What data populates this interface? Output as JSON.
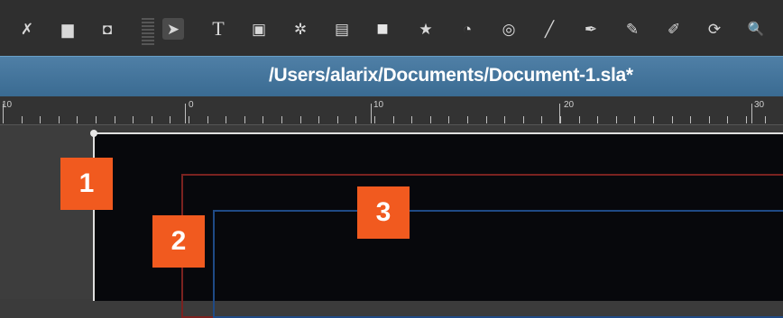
{
  "toolbar": {
    "tools": [
      {
        "name": "cut-icon",
        "glyph": "✗"
      },
      {
        "name": "copy-icon",
        "glyph": "▆"
      },
      {
        "name": "paste-icon",
        "glyph": "◘"
      },
      {
        "name": "select-icon",
        "glyph": "➤"
      },
      {
        "name": "text-frame-icon",
        "glyph": "T"
      },
      {
        "name": "image-frame-icon",
        "glyph": "▣"
      },
      {
        "name": "render-frame-icon",
        "glyph": "✲"
      },
      {
        "name": "table-icon",
        "glyph": "▤"
      },
      {
        "name": "shape-icon",
        "glyph": "■"
      },
      {
        "name": "polygon-icon",
        "glyph": "★"
      },
      {
        "name": "arc-icon",
        "glyph": "◔"
      },
      {
        "name": "spiral-icon",
        "glyph": "◎"
      },
      {
        "name": "line-icon",
        "glyph": "╱"
      },
      {
        "name": "bezier-icon",
        "glyph": "✒"
      },
      {
        "name": "freehand-icon",
        "glyph": "✎"
      },
      {
        "name": "calligraphic-icon",
        "glyph": "✐"
      },
      {
        "name": "rotate-icon",
        "glyph": "⟳"
      },
      {
        "name": "zoom-icon",
        "glyph": "🔍"
      }
    ]
  },
  "titlebar": {
    "path": "/Users/alarix/Documents/Document-1.sla*"
  },
  "ruler": {
    "labels": [
      "10",
      "0",
      "10",
      "20",
      "30"
    ]
  },
  "markers": [
    "1",
    "2",
    "3"
  ]
}
